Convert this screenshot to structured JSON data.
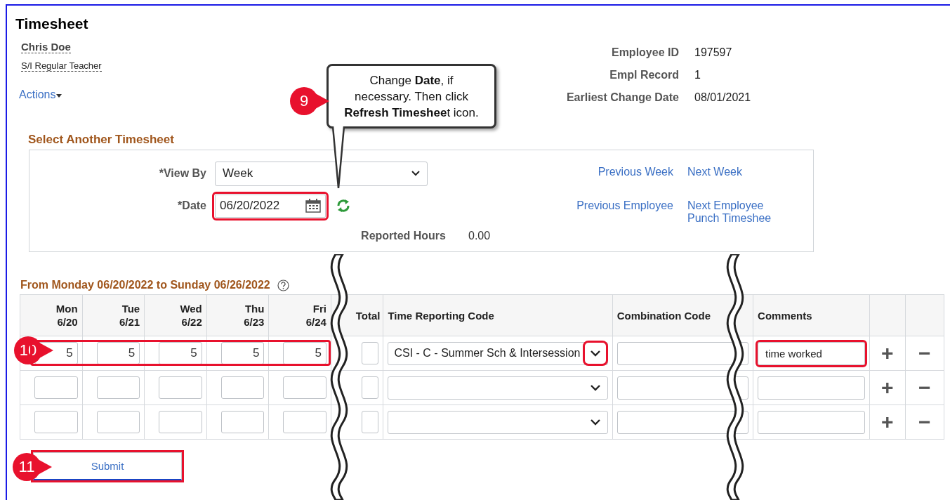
{
  "title": "Timesheet",
  "employee": {
    "name": "Chris Doe",
    "job": "S/I Regular Teacher",
    "actions": "Actions"
  },
  "info": [
    {
      "label": "Employee ID",
      "value": "197597"
    },
    {
      "label": "Empl Record",
      "value": "1"
    },
    {
      "label": "Earliest Change Date",
      "value": "08/01/2021"
    }
  ],
  "select_another": {
    "title": "Select Another Timesheet",
    "view_by": {
      "label": "*View By",
      "value": "Week"
    },
    "date": {
      "label": "*Date",
      "value": "06/20/2022",
      "highlighted": true
    },
    "reported": {
      "label": "Reported Hours",
      "value": "0.00"
    },
    "links": [
      {
        "label": "Previous Week"
      },
      {
        "label": "Next Week"
      },
      {
        "label": "Previous Employee"
      },
      {
        "label": "Next Employee"
      },
      {
        "label": "Punch Timeshee"
      }
    ]
  },
  "period": "From Monday 06/20/2022 to Sunday 06/26/2022",
  "table": {
    "columns": [
      {
        "kind": "day",
        "label": "Mon",
        "sub": "6/20"
      },
      {
        "kind": "day",
        "label": "Tue",
        "sub": "6/21"
      },
      {
        "kind": "day",
        "label": "Wed",
        "sub": "6/22"
      },
      {
        "kind": "day",
        "label": "Thu",
        "sub": "6/23"
      },
      {
        "kind": "day",
        "label": "Fri",
        "sub": "6/24"
      },
      {
        "kind": "total",
        "label": "Total"
      },
      {
        "kind": "code",
        "label": "Time Reporting Code"
      },
      {
        "kind": "combo",
        "label": "Combination Code"
      },
      {
        "kind": "comment",
        "label": "Comments"
      },
      {
        "kind": "add"
      },
      {
        "kind": "remove"
      }
    ],
    "rows": [
      {
        "hours": [
          "5",
          "5",
          "5",
          "5",
          "5"
        ],
        "hours_highlighted": true,
        "code": "CSI - C - Summer Sch & Intersession",
        "code_highlighted": true,
        "comment": "time worked",
        "comment_highlighted": true,
        "add": "+",
        "remove": "−"
      },
      {
        "code_highlighted": false,
        "comment_highlighted": false,
        "add": "+",
        "remove": "−"
      },
      {
        "code_highlighted": false,
        "comment_highlighted": false,
        "add": "+",
        "remove": "−"
      }
    ]
  },
  "submit": {
    "label": "Submit",
    "highlighted": true
  },
  "callouts": [
    {
      "number": "9",
      "text": "Change **Date**, if\nnecessary. Then click\n**Refresh Timeshee**t icon."
    },
    {
      "number": "10"
    },
    {
      "number": "11"
    }
  ]
}
